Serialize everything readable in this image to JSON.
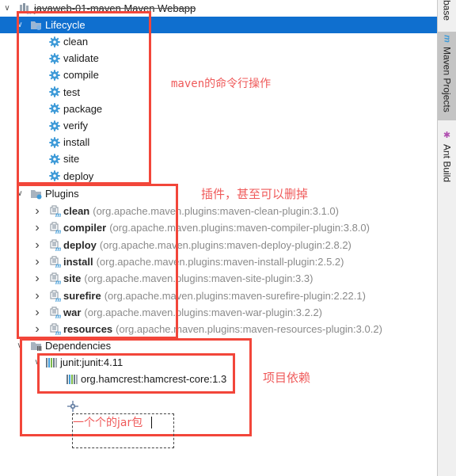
{
  "project": {
    "title": "javaweb-01-maven Maven Webapp"
  },
  "lifecycle": {
    "label": "Lifecycle",
    "phases": [
      "clean",
      "validate",
      "compile",
      "test",
      "package",
      "verify",
      "install",
      "site",
      "deploy"
    ]
  },
  "plugins": {
    "label": "Plugins",
    "items": [
      {
        "name": "clean",
        "coords": "(org.apache.maven.plugins:maven-clean-plugin:3.1.0)"
      },
      {
        "name": "compiler",
        "coords": "(org.apache.maven.plugins:maven-compiler-plugin:3.8.0)"
      },
      {
        "name": "deploy",
        "coords": "(org.apache.maven.plugins:maven-deploy-plugin:2.8.2)"
      },
      {
        "name": "install",
        "coords": "(org.apache.maven.plugins:maven-install-plugin:2.5.2)"
      },
      {
        "name": "site",
        "coords": "(org.apache.maven.plugins:maven-site-plugin:3.3)"
      },
      {
        "name": "surefire",
        "coords": "(org.apache.maven.plugins:maven-surefire-plugin:2.22.1)"
      },
      {
        "name": "war",
        "coords": "(org.apache.maven.plugins:maven-war-plugin:3.2.2)"
      },
      {
        "name": "resources",
        "coords": "(org.apache.maven.plugins:maven-resources-plugin:3.0.2)"
      }
    ]
  },
  "dependencies": {
    "label": "Dependencies",
    "items": [
      {
        "name": "junit:junit:4.11",
        "children": [
          "org.hamcrest:hamcrest-core:1.3"
        ]
      }
    ]
  },
  "annotations": {
    "lifecycle_note": "maven的命令行操作",
    "plugins_note": "插件，甚至可以删掉",
    "dependencies_note": "项目依赖",
    "jar_note": "一个个的jar包"
  },
  "sidebar": {
    "tabs": [
      {
        "label": "base",
        "icon": ""
      },
      {
        "label": "Maven Projects",
        "icon": "m"
      },
      {
        "label": "Ant Build",
        "icon": "✱"
      }
    ]
  },
  "colors": {
    "selection": "#0f6fcf",
    "annotation_red": "#f2463a",
    "gear_blue": "#3f9bd8"
  }
}
